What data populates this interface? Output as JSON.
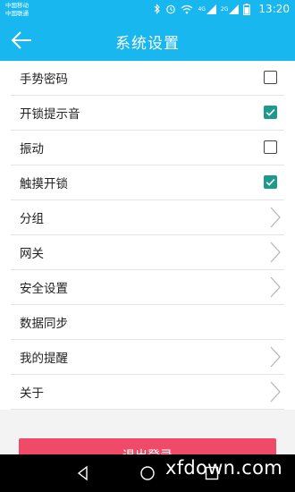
{
  "status_bar": {
    "carrier_1": "中国移动",
    "carrier_2": "中国联通",
    "network_1": "4G",
    "network_2": "2G",
    "time": "13:20"
  },
  "header": {
    "title": "系统设置",
    "back_icon": "arrow-left-icon"
  },
  "settings": [
    {
      "label": "手势密码",
      "control": "checkbox",
      "checked": false
    },
    {
      "label": "开锁提示音",
      "control": "checkbox",
      "checked": true
    },
    {
      "label": "振动",
      "control": "checkbox",
      "checked": false
    },
    {
      "label": "触摸开锁",
      "control": "checkbox",
      "checked": true
    },
    {
      "label": "分组",
      "control": "chevron"
    },
    {
      "label": "网关",
      "control": "chevron"
    },
    {
      "label": "安全设置",
      "control": "chevron"
    },
    {
      "label": "数据同步",
      "control": "none"
    },
    {
      "label": "我的提醒",
      "control": "chevron"
    },
    {
      "label": "关于",
      "control": "chevron"
    }
  ],
  "logout_button": {
    "label": "退出登录"
  },
  "watermark": "xfdown.com",
  "colors": {
    "accent": "#18b7f0",
    "checkbox_checked": "#1d9a8c",
    "logout": "#ef4a68"
  }
}
